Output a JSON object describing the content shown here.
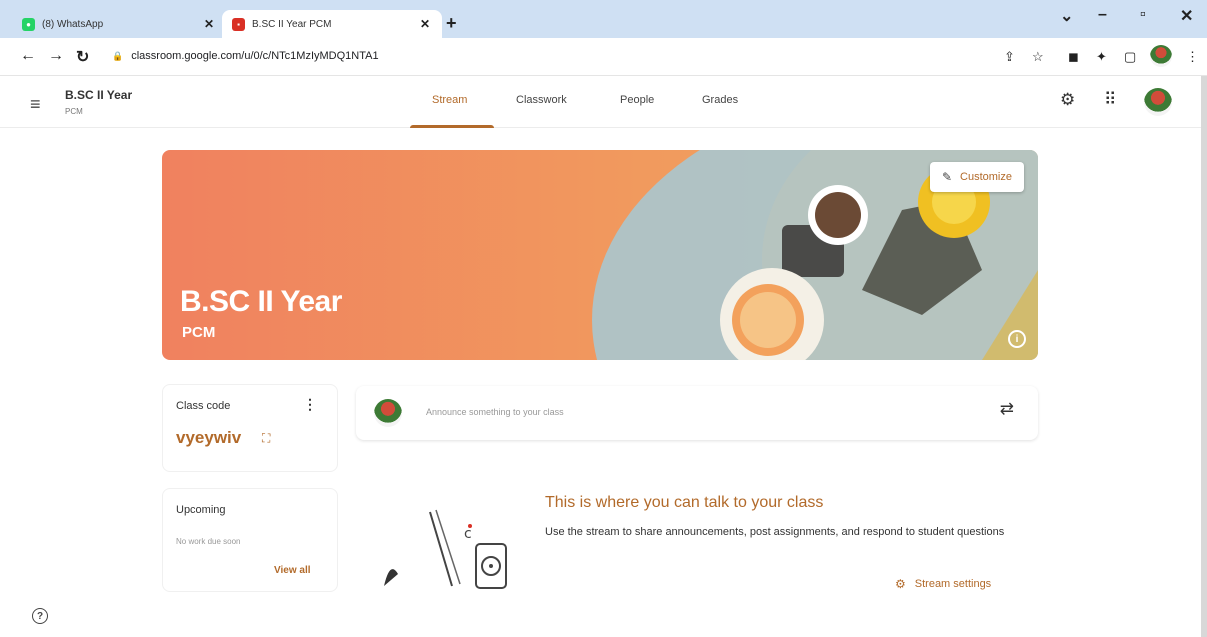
{
  "browser": {
    "tabs": [
      {
        "title": "(8) WhatsApp",
        "favicon_color": "#25D366",
        "active": false
      },
      {
        "title": "B.SC II Year PCM",
        "favicon_color": "#d93025",
        "active": true
      }
    ],
    "url": "classroom.google.com/u/0/c/NTc1MzIyMDQ1NTA1"
  },
  "header": {
    "class_name": "B.SC II Year",
    "section": "PCM",
    "tabs": [
      "Stream",
      "Classwork",
      "People",
      "Grades"
    ],
    "active_tab": "Stream"
  },
  "banner": {
    "title": "B.SC II Year",
    "subtitle": "PCM",
    "customize_label": "Customize",
    "accent": "#f0815f"
  },
  "class_code": {
    "label": "Class code",
    "value": "vyeywiv"
  },
  "upcoming": {
    "label": "Upcoming",
    "empty_text": "No work due soon",
    "view_all": "View all"
  },
  "announce": {
    "placeholder": "Announce something to your class"
  },
  "empty_state": {
    "title": "This is where you can talk to your class",
    "description": "Use the stream to share announcements, post assignments, and respond to student questions",
    "settings_label": "Stream settings"
  },
  "colors": {
    "brand": "#b26a2a",
    "tabstrip": "#cfe0f3"
  }
}
